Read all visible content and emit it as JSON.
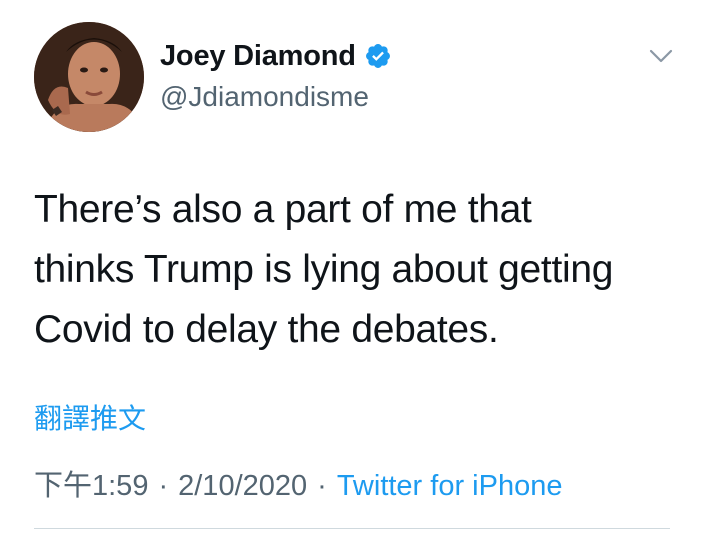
{
  "author": {
    "display_name": "Joey Diamond",
    "handle": "@Jdiamondisme",
    "verified": true,
    "avatar_icon": "profile-photo"
  },
  "tweet": {
    "text_lines": [
      "There’s also a part of me that",
      "thinks Trump is lying about getting",
      "Covid to delay the debates."
    ],
    "translate_label": "翻譯推文"
  },
  "meta": {
    "time": "下午1:59",
    "separator": "·",
    "date": "2/10/2020",
    "source": "Twitter for iPhone"
  },
  "colors": {
    "link_blue": "#1d9bf0",
    "verified_blue": "#1d9bf0",
    "secondary_text": "#536471"
  }
}
